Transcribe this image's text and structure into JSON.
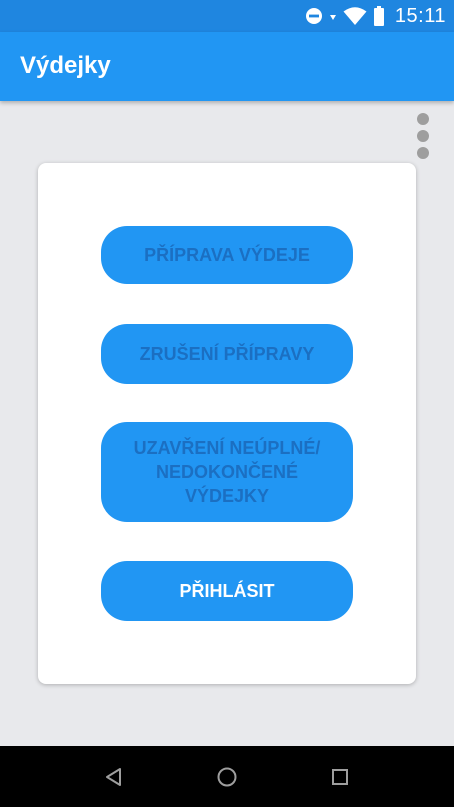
{
  "status_bar": {
    "time": "15:11",
    "icons": [
      "do-not-disturb-icon",
      "data-arrows-icon",
      "wifi-icon",
      "battery-icon"
    ]
  },
  "app_bar": {
    "title": "Výdejky"
  },
  "menu": {
    "overflow_icon": "more-vert-icon"
  },
  "card": {
    "buttons": [
      {
        "label": "PŘÍPRAVA VÝDEJE",
        "enabled": false
      },
      {
        "label": "ZRUŠENÍ PŘÍPRAVY",
        "enabled": false
      },
      {
        "label": "UZAVŘENÍ NEÚPLNÉ/ NEDOKONČENÉ VÝDEJKY",
        "enabled": false
      },
      {
        "label": "PŘIHLÁSIT",
        "enabled": true
      }
    ]
  },
  "nav_bar": {
    "icons": [
      "back-icon",
      "home-icon",
      "recents-icon"
    ]
  },
  "colors": {
    "status_bar": "#1f86e0",
    "app_bar": "#2196f3",
    "background": "#e8e9ec",
    "button": "#2196f3",
    "button_disabled_text": "#1b6fc2",
    "button_active_text": "#ffffff"
  }
}
